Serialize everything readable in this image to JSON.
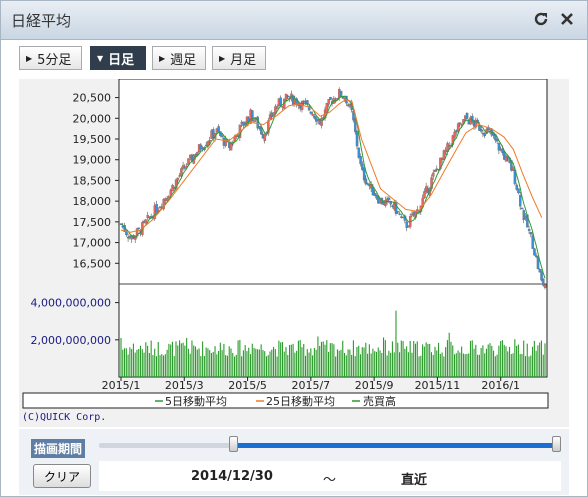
{
  "widget": {
    "title": "日経平均",
    "refresh_icon": "refresh-icon",
    "close_icon": "close-icon"
  },
  "tabs": [
    {
      "label": "5分足",
      "active": false
    },
    {
      "label": "日足",
      "active": true
    },
    {
      "label": "週足",
      "active": false
    },
    {
      "label": "月足",
      "active": false
    }
  ],
  "legend": {
    "ma5": "5日移動平均",
    "ma25": "25日移動平均",
    "volume": "売買高"
  },
  "copyright": "(C)QUICK Corp.",
  "period": {
    "label": "描画期間",
    "clear_label": "クリア",
    "start": "2014/12/30",
    "separator": "〜",
    "end": "直近",
    "slider_start": 0.29,
    "slider_end": 1.0
  },
  "colors": {
    "up": "#e8665f",
    "down": "#3a8fd8",
    "ma5": "#2e9a3a",
    "ma25": "#f07a2a",
    "volume": "#2a9a2a",
    "accent": "#1a6fd2"
  },
  "chart_data": {
    "type": "candlestick",
    "price_ticks": [
      "20,500",
      "20,000",
      "19,500",
      "19,000",
      "18,500",
      "18,000",
      "17,500",
      "17,000",
      "16,500"
    ],
    "price_tick_values": [
      20500,
      20000,
      19500,
      19000,
      18500,
      18000,
      17500,
      17000,
      16500
    ],
    "price_range": [
      16000,
      20900
    ],
    "volume_ticks": [
      "4,000,000,000",
      "2,000,000,000"
    ],
    "volume_tick_values": [
      4000000000,
      2000000000
    ],
    "volume_range": [
      0,
      5000000000
    ],
    "x_tick_labels": [
      "2015/1",
      "2015/3",
      "2015/5",
      "2015/7",
      "2015/9",
      "2015/11",
      "2016/1"
    ],
    "x_tick_month_index": [
      0,
      2,
      4,
      6,
      8,
      10,
      12
    ],
    "months_span": 13.4,
    "close_path_months": [
      0,
      0.3,
      0.6,
      1.0,
      1.5,
      2.0,
      2.5,
      3.0,
      3.4,
      3.8,
      4.1,
      4.5,
      4.9,
      5.3,
      5.6,
      6.0,
      6.3,
      6.6,
      6.9,
      7.1,
      7.3,
      7.6,
      7.9,
      8.2,
      8.6,
      9.0,
      9.4,
      9.8,
      10.2,
      10.6,
      10.9,
      11.3,
      11.7,
      12.1,
      12.4,
      12.7,
      13.0,
      13.3
    ],
    "close_path_values": [
      17450,
      17100,
      17300,
      17700,
      18200,
      18800,
      19300,
      19700,
      19300,
      19800,
      20100,
      19600,
      20300,
      20500,
      20400,
      20200,
      19900,
      20400,
      20600,
      20500,
      20100,
      18700,
      18300,
      18000,
      17900,
      17400,
      17800,
      18500,
      19100,
      19700,
      20000,
      19800,
      19600,
      19100,
      18700,
      17700,
      17000,
      16000
    ],
    "ma25_path_values": [
      17300,
      17250,
      17300,
      17550,
      18000,
      18500,
      19000,
      19500,
      19450,
      19700,
      19900,
      19850,
      20050,
      20300,
      20350,
      20250,
      20050,
      20150,
      20350,
      20450,
      20400,
      19500,
      18900,
      18300,
      18050,
      17800,
      17750,
      18150,
      18700,
      19250,
      19650,
      19850,
      19750,
      19550,
      19250,
      18650,
      18100,
      17600
    ]
  }
}
